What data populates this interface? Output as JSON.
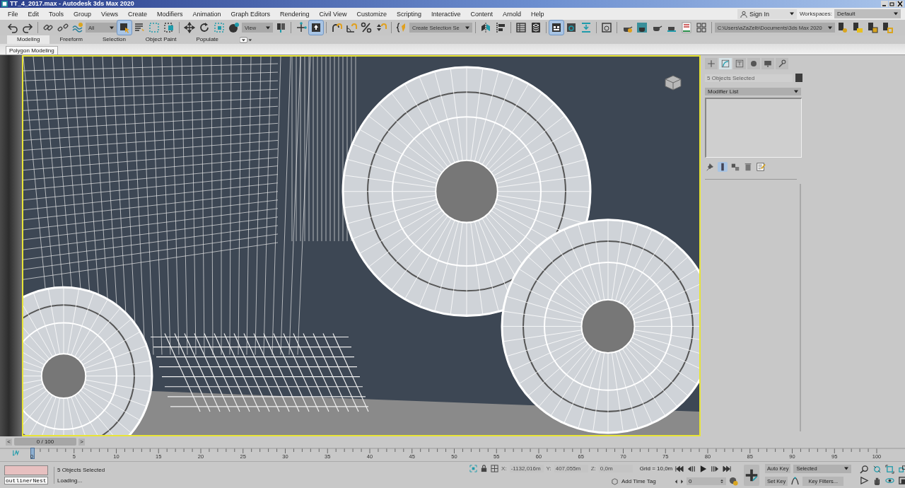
{
  "window": {
    "title": "TT_4_2017.max - Autodesk 3ds Max 2020"
  },
  "menu": [
    "File",
    "Edit",
    "Tools",
    "Group",
    "Views",
    "Create",
    "Modifiers",
    "Animation",
    "Graph Editors",
    "Rendering",
    "Civil View",
    "Customize",
    "Scripting",
    "Interactive",
    "Content",
    "Arnold",
    "Help"
  ],
  "account": {
    "label": "Sign In"
  },
  "workspaces": {
    "label": "Workspaces:",
    "value": "Default"
  },
  "toolbar": [
    {
      "kind": "button",
      "selected": false
    },
    {
      "kind": "button",
      "selected": false
    },
    {
      "kind": "separator"
    },
    {
      "kind": "button",
      "selected": false
    },
    {
      "kind": "button",
      "selected": false
    },
    {
      "kind": "button",
      "selected": false
    },
    {
      "kind": "dropdown",
      "value": "All"
    },
    {
      "kind": "button",
      "selected": true
    },
    {
      "kind": "button",
      "selected": false
    },
    {
      "kind": "button",
      "selected": false
    },
    {
      "kind": "button",
      "selected": false
    },
    {
      "kind": "separator"
    },
    {
      "kind": "button",
      "selected": false
    },
    {
      "kind": "button",
      "selected": false
    },
    {
      "kind": "button",
      "selected": false
    },
    {
      "kind": "button",
      "selected": false
    },
    {
      "kind": "dropdown",
      "value": "View"
    },
    {
      "kind": "button",
      "selected": false
    },
    {
      "kind": "separator"
    },
    {
      "kind": "button",
      "selected": false
    },
    {
      "kind": "button",
      "selected": true
    },
    {
      "kind": "separator"
    },
    {
      "kind": "button",
      "selected": false
    },
    {
      "kind": "button",
      "selected": false
    },
    {
      "kind": "button",
      "selected": false
    },
    {
      "kind": "button",
      "selected": false
    },
    {
      "kind": "separator"
    },
    {
      "kind": "button",
      "selected": false
    },
    {
      "kind": "dropdown",
      "value": "Create Selection Se"
    },
    {
      "kind": "separator"
    },
    {
      "kind": "button",
      "selected": false
    },
    {
      "kind": "button",
      "selected": false
    },
    {
      "kind": "separator"
    },
    {
      "kind": "button",
      "selected": false
    },
    {
      "kind": "button",
      "selected": false
    },
    {
      "kind": "separator"
    },
    {
      "kind": "button",
      "selected": true
    },
    {
      "kind": "button",
      "selected": false
    },
    {
      "kind": "button",
      "selected": false
    },
    {
      "kind": "separator"
    },
    {
      "kind": "button",
      "selected": false
    },
    {
      "kind": "separator"
    },
    {
      "kind": "button",
      "selected": false
    },
    {
      "kind": "button",
      "selected": false
    },
    {
      "kind": "button",
      "selected": false
    },
    {
      "kind": "button",
      "selected": false
    },
    {
      "kind": "button",
      "selected": false
    },
    {
      "kind": "button",
      "selected": false
    },
    {
      "kind": "separator"
    },
    {
      "kind": "dropdown",
      "value": "C:\\Users\\aZaZelb\\Documents\\3ds Max 2020"
    },
    {
      "kind": "button",
      "selected": false
    },
    {
      "kind": "button",
      "selected": false
    },
    {
      "kind": "button",
      "selected": false
    },
    {
      "kind": "button",
      "selected": false
    }
  ],
  "ribbon_tabs": [
    {
      "label": "Modeling",
      "selected": true
    },
    {
      "label": "Freeform",
      "selected": false
    },
    {
      "label": "Selection",
      "selected": false
    },
    {
      "label": "Object Paint",
      "selected": false
    },
    {
      "label": "Populate",
      "selected": false
    }
  ],
  "ribbon_panel": {
    "label": "Polygon Modeling"
  },
  "command_panel": {
    "tabs": [
      {
        "selected": false
      },
      {
        "selected": true
      },
      {
        "selected": false
      },
      {
        "selected": false
      },
      {
        "selected": false
      },
      {
        "selected": false
      }
    ],
    "name_field": {
      "value": "5 Objects Selected",
      "disabled": true
    },
    "modifier_list": "Modifier List",
    "stack_buttons": [
      {
        "selected": false
      },
      {
        "selected": true
      },
      {
        "selected": false
      },
      {
        "selected": false
      },
      {
        "selected": false
      }
    ]
  },
  "time_slider": {
    "prev": "<",
    "label": "0 / 100",
    "next": ">",
    "level": 0
  },
  "timeline": {
    "ticks": [
      "0",
      "5",
      "10",
      "15",
      "20",
      "25",
      "30",
      "35",
      "40",
      "45",
      "50",
      "55",
      "60",
      "65",
      "70",
      "75",
      "80",
      "85",
      "90",
      "95",
      "100"
    ]
  },
  "listener": {
    "input": "outlinerNest"
  },
  "status": {
    "selection": "5 Objects Selected",
    "prompt": "Loading..."
  },
  "coordinates": [
    {
      "label": "X:",
      "value": "-1132,016m",
      "disabled": true
    },
    {
      "label": "Y:",
      "value": "407,055m",
      "disabled": true
    },
    {
      "label": "Z:",
      "value": "0,0m",
      "disabled": true
    }
  ],
  "grid": "Grid = 10,0m",
  "time_tag": "Add Time Tag",
  "frame": "0",
  "auto_key": {
    "label": "Auto Key",
    "on": false
  },
  "set_key": "Set Key",
  "key_mode": "Selected",
  "key_filters": "Key Filters..."
}
